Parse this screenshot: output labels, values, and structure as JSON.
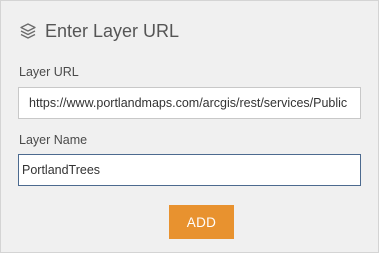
{
  "header": {
    "icon": "layers-icon",
    "title": "Enter Layer URL"
  },
  "form": {
    "url_label": "Layer URL",
    "url_value": "https://www.portlandmaps.com/arcgis/rest/services/Public",
    "name_label": "Layer Name",
    "name_value": "PortlandTrees"
  },
  "actions": {
    "add_label": "ADD"
  },
  "colors": {
    "accent_button": "#e8922f",
    "focus_border": "#4c6a8f",
    "panel_background": "#f0f0f0"
  }
}
